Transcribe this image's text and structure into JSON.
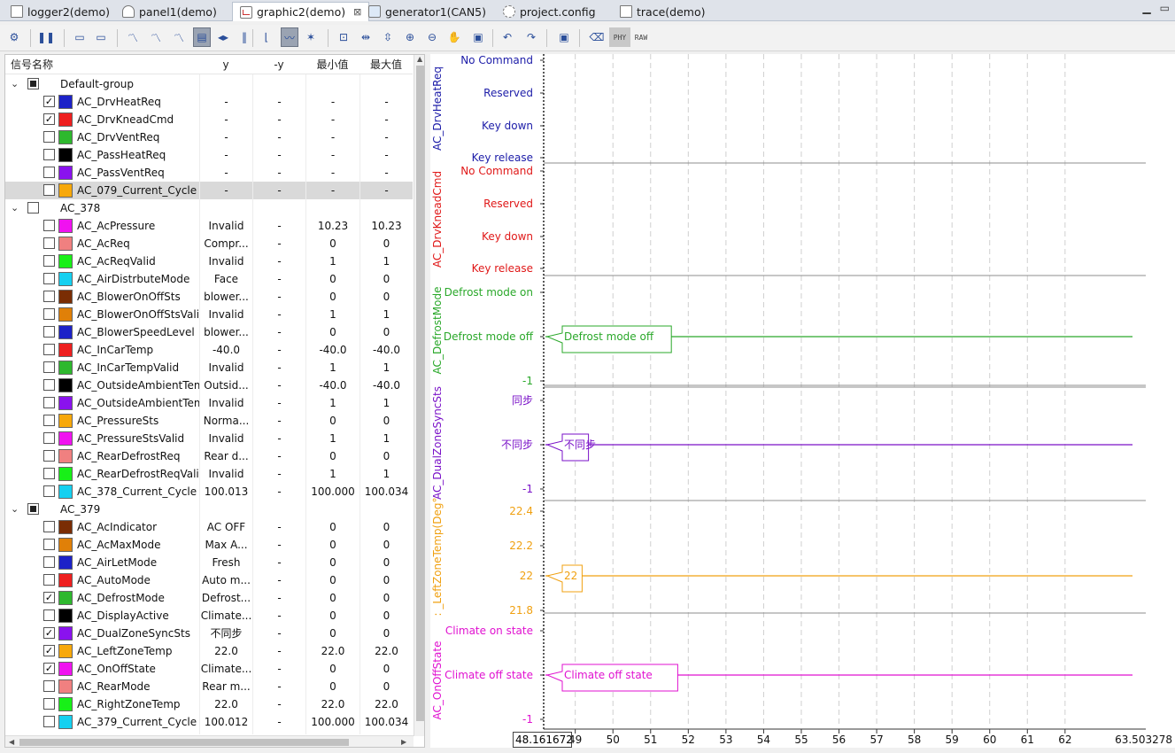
{
  "tabs": [
    {
      "label": "logger2(demo)",
      "icon": "document-icon",
      "active": false
    },
    {
      "label": "panel1(demo)",
      "icon": "gauge-icon",
      "active": false
    },
    {
      "label": "graphic2(demo)",
      "icon": "chart-icon",
      "active": true
    },
    {
      "label": "generator1(CAN5)",
      "icon": "computer-icon",
      "active": false
    },
    {
      "label": "project.config",
      "icon": "tools-icon",
      "active": false
    },
    {
      "label": "trace(demo)",
      "icon": "document-icon",
      "active": false
    }
  ],
  "toolbar": {
    "phy_label": "PHY",
    "raw_label": "RAW"
  },
  "signal_table": {
    "headers": [
      "信号名称",
      "y",
      "-y",
      "最小值",
      "最大值"
    ],
    "groups": [
      {
        "name": "Default-group",
        "checked": "partial",
        "signals": [
          {
            "name": "AC_DrvHeatReq",
            "checked": true,
            "color": "#1c22c8",
            "y": "-",
            "dy": "-",
            "min": "-",
            "max": "-"
          },
          {
            "name": "AC_DrvKneadCmd",
            "checked": true,
            "color": "#ee1f1f",
            "y": "-",
            "dy": "-",
            "min": "-",
            "max": "-"
          },
          {
            "name": "AC_DrvVentReq",
            "checked": false,
            "color": "#2eb82e",
            "y": "-",
            "dy": "-",
            "min": "-",
            "max": "-"
          },
          {
            "name": "AC_PassHeatReq",
            "checked": false,
            "color": "#000000",
            "y": "-",
            "dy": "-",
            "min": "-",
            "max": "-"
          },
          {
            "name": "AC_PassVentReq",
            "checked": false,
            "color": "#8a12ee",
            "y": "-",
            "dy": "-",
            "min": "-",
            "max": "-"
          },
          {
            "name": "AC_079_Current_Cycle",
            "checked": false,
            "color": "#f7a80a",
            "y": "-",
            "dy": "-",
            "min": "-",
            "max": "-",
            "selected": true
          }
        ]
      },
      {
        "name": "AC_378",
        "checked": "none",
        "signals": [
          {
            "name": "AC_AcPressure",
            "checked": false,
            "color": "#f012f0",
            "y": "Invalid",
            "dy": "-",
            "min": "10.23",
            "max": "10.23"
          },
          {
            "name": "AC_AcReq",
            "checked": false,
            "color": "#f08080",
            "y": "Compr...",
            "dy": "-",
            "min": "0",
            "max": "0"
          },
          {
            "name": "AC_AcReqValid",
            "checked": false,
            "color": "#18f018",
            "y": "Invalid",
            "dy": "-",
            "min": "1",
            "max": "1"
          },
          {
            "name": "AC_AirDistrbuteMode",
            "checked": false,
            "color": "#15d0f0",
            "y": "Face",
            "dy": "-",
            "min": "0",
            "max": "0"
          },
          {
            "name": "AC_BlowerOnOffSts",
            "checked": false,
            "color": "#7a2d04",
            "y": "blower...",
            "dy": "-",
            "min": "0",
            "max": "0"
          },
          {
            "name": "AC_BlowerOnOffStsValid",
            "checked": false,
            "color": "#e08008",
            "y": "Invalid",
            "dy": "-",
            "min": "1",
            "max": "1"
          },
          {
            "name": "AC_BlowerSpeedLevel",
            "checked": false,
            "color": "#1c22c8",
            "y": "blower...",
            "dy": "-",
            "min": "0",
            "max": "0"
          },
          {
            "name": "AC_InCarTemp",
            "checked": false,
            "color": "#ee1f1f",
            "y": "-40.0",
            "dy": "-",
            "min": "-40.0",
            "max": "-40.0"
          },
          {
            "name": "AC_InCarTempValid",
            "checked": false,
            "color": "#2eb82e",
            "y": "Invalid",
            "dy": "-",
            "min": "1",
            "max": "1"
          },
          {
            "name": "AC_OutsideAmbientTemp",
            "checked": false,
            "color": "#000000",
            "y": "Outsid...",
            "dy": "-",
            "min": "-40.0",
            "max": "-40.0"
          },
          {
            "name": "AC_OutsideAmbientTempValid",
            "checked": false,
            "color": "#8a12ee",
            "y": "Invalid",
            "dy": "-",
            "min": "1",
            "max": "1"
          },
          {
            "name": "AC_PressureSts",
            "checked": false,
            "color": "#f7a80a",
            "y": "Norma...",
            "dy": "-",
            "min": "0",
            "max": "0"
          },
          {
            "name": "AC_PressureStsValid",
            "checked": false,
            "color": "#f012f0",
            "y": "Invalid",
            "dy": "-",
            "min": "1",
            "max": "1"
          },
          {
            "name": "AC_RearDefrostReq",
            "checked": false,
            "color": "#f08080",
            "y": "Rear d...",
            "dy": "-",
            "min": "0",
            "max": "0"
          },
          {
            "name": "AC_RearDefrostReqValid",
            "checked": false,
            "color": "#18f018",
            "y": "Invalid",
            "dy": "-",
            "min": "1",
            "max": "1"
          },
          {
            "name": "AC_378_Current_Cycle",
            "checked": false,
            "color": "#15d0f0",
            "y": "100.013",
            "dy": "-",
            "min": "100.000",
            "max": "100.034"
          }
        ]
      },
      {
        "name": "AC_379",
        "checked": "partial",
        "signals": [
          {
            "name": "AC_AcIndicator",
            "checked": false,
            "color": "#7a2d04",
            "y": "AC OFF",
            "dy": "-",
            "min": "0",
            "max": "0"
          },
          {
            "name": "AC_AcMaxMode",
            "checked": false,
            "color": "#e08008",
            "y": "Max A...",
            "dy": "-",
            "min": "0",
            "max": "0"
          },
          {
            "name": "AC_AirLetMode",
            "checked": false,
            "color": "#1c22c8",
            "y": "Fresh",
            "dy": "-",
            "min": "0",
            "max": "0"
          },
          {
            "name": "AC_AutoMode",
            "checked": false,
            "color": "#ee1f1f",
            "y": "Auto m...",
            "dy": "-",
            "min": "0",
            "max": "0"
          },
          {
            "name": "AC_DefrostMode",
            "checked": true,
            "color": "#2eb82e",
            "y": "Defrost...",
            "dy": "-",
            "min": "0",
            "max": "0"
          },
          {
            "name": "AC_DisplayActive",
            "checked": false,
            "color": "#000000",
            "y": "Climate...",
            "dy": "-",
            "min": "0",
            "max": "0"
          },
          {
            "name": "AC_DualZoneSyncSts",
            "checked": true,
            "color": "#8a12ee",
            "y": "不同步",
            "dy": "-",
            "min": "0",
            "max": "0"
          },
          {
            "name": "AC_LeftZoneTemp",
            "checked": true,
            "color": "#f7a80a",
            "y": "22.0",
            "dy": "-",
            "min": "22.0",
            "max": "22.0"
          },
          {
            "name": "AC_OnOffState",
            "checked": true,
            "color": "#f012f0",
            "y": "Climate...",
            "dy": "-",
            "min": "0",
            "max": "0"
          },
          {
            "name": "AC_RearMode",
            "checked": false,
            "color": "#f08080",
            "y": "Rear m...",
            "dy": "-",
            "min": "0",
            "max": "0"
          },
          {
            "name": "AC_RightZoneTemp",
            "checked": false,
            "color": "#18f018",
            "y": "22.0",
            "dy": "-",
            "min": "22.0",
            "max": "22.0"
          },
          {
            "name": "AC_379_Current_Cycle",
            "checked": false,
            "color": "#15d0f0",
            "y": "100.012",
            "dy": "-",
            "min": "100.000",
            "max": "100.034"
          }
        ]
      }
    ]
  },
  "graph": {
    "cursor_time": "48.161672",
    "x_axis": {
      "start_label": "48.161672",
      "ticks": [
        "49",
        "50",
        "51",
        "52",
        "53",
        "54",
        "55",
        "56",
        "57",
        "58",
        "59",
        "60",
        "61",
        "62"
      ],
      "end_label": "63.503278"
    },
    "panels": [
      {
        "name": "AC_DrvHeatReq",
        "color": "#1c1ca8",
        "labels": [
          "No Command",
          "Reserved",
          "Key down",
          "Key release"
        ],
        "trace": null,
        "value_label": null
      },
      {
        "name": "AC_DrvKneadCmd",
        "color": "#e01818",
        "labels": [
          "No Command",
          "Reserved",
          "Key down",
          "Key release"
        ],
        "trace": null,
        "value_label": null
      },
      {
        "name": "AC_DefrostMode",
        "color": "#2aa82a",
        "labels": [
          "Defrost mode on",
          "Defrost mode off",
          "-1"
        ],
        "trace": "Defrost mode off",
        "value_label": "Defrost mode off"
      },
      {
        "name": "AC_DualZoneSyncSts",
        "color": "#7a12c8",
        "labels": [
          "同步",
          "不同步",
          "-1"
        ],
        "trace": "不同步",
        "value_label": "不同步"
      },
      {
        "name": ": _LeftZoneTemp(Deg°",
        "color": "#f0a010",
        "labels": [
          "22.4",
          "22.2",
          "22",
          "21.8"
        ],
        "trace": "22",
        "value_label": "22"
      },
      {
        "name": "AC_OnOffState",
        "color": "#e012d0",
        "labels": [
          "Climate on state",
          "Climate off state",
          "-1"
        ],
        "trace": "Climate off state",
        "value_label": "Climate off state"
      }
    ]
  }
}
